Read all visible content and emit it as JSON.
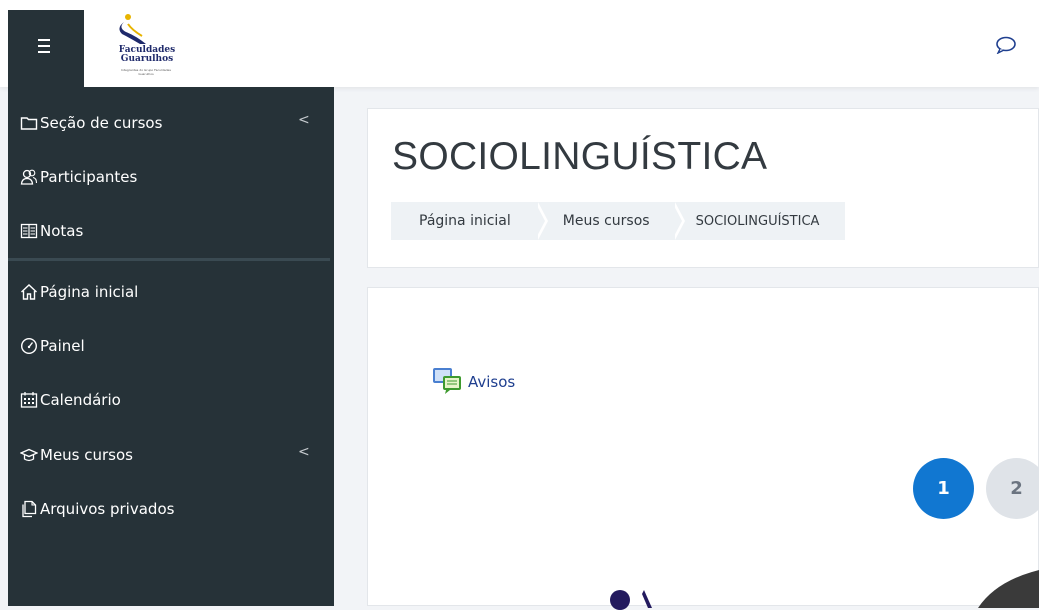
{
  "topbar": {
    "menu_icon": "hamburger-icon",
    "logo": {
      "line1": "Faculdades",
      "line2": "Guarulhos",
      "tagline": "Integrantes do Grupo Faculdades Guarulhos"
    },
    "chat_icon": "chat-bubble-icon"
  },
  "drawer": {
    "items": [
      {
        "label": "Seção de cursos",
        "icon": "folder-icon",
        "has_chevron": true
      },
      {
        "label": "Participantes",
        "icon": "users-icon",
        "has_chevron": false
      },
      {
        "label": "Notas",
        "icon": "table-icon",
        "has_chevron": false
      },
      {
        "label": "Página inicial",
        "icon": "home-icon",
        "has_chevron": false
      },
      {
        "label": "Painel",
        "icon": "dashboard-icon",
        "has_chevron": false
      },
      {
        "label": "Calendário",
        "icon": "calendar-icon",
        "has_chevron": false
      },
      {
        "label": "Meus cursos",
        "icon": "graduation-cap-icon",
        "has_chevron": true
      },
      {
        "label": "Arquivos privados",
        "icon": "files-icon",
        "has_chevron": false
      }
    ],
    "chevron": "<"
  },
  "header": {
    "title": "SOCIOLINGUÍSTICA",
    "breadcrumb": [
      "Página inicial",
      "Meus cursos",
      "SOCIOLINGUÍSTICA"
    ]
  },
  "content": {
    "forum_label": "Avisos",
    "pages": [
      "1",
      "2"
    ],
    "active_page": "1"
  },
  "colors": {
    "drawer_bg": "#263238",
    "accent": "#1177d1",
    "link": "#1f3f8f",
    "breadcrumb_bg": "#eef2f5"
  }
}
